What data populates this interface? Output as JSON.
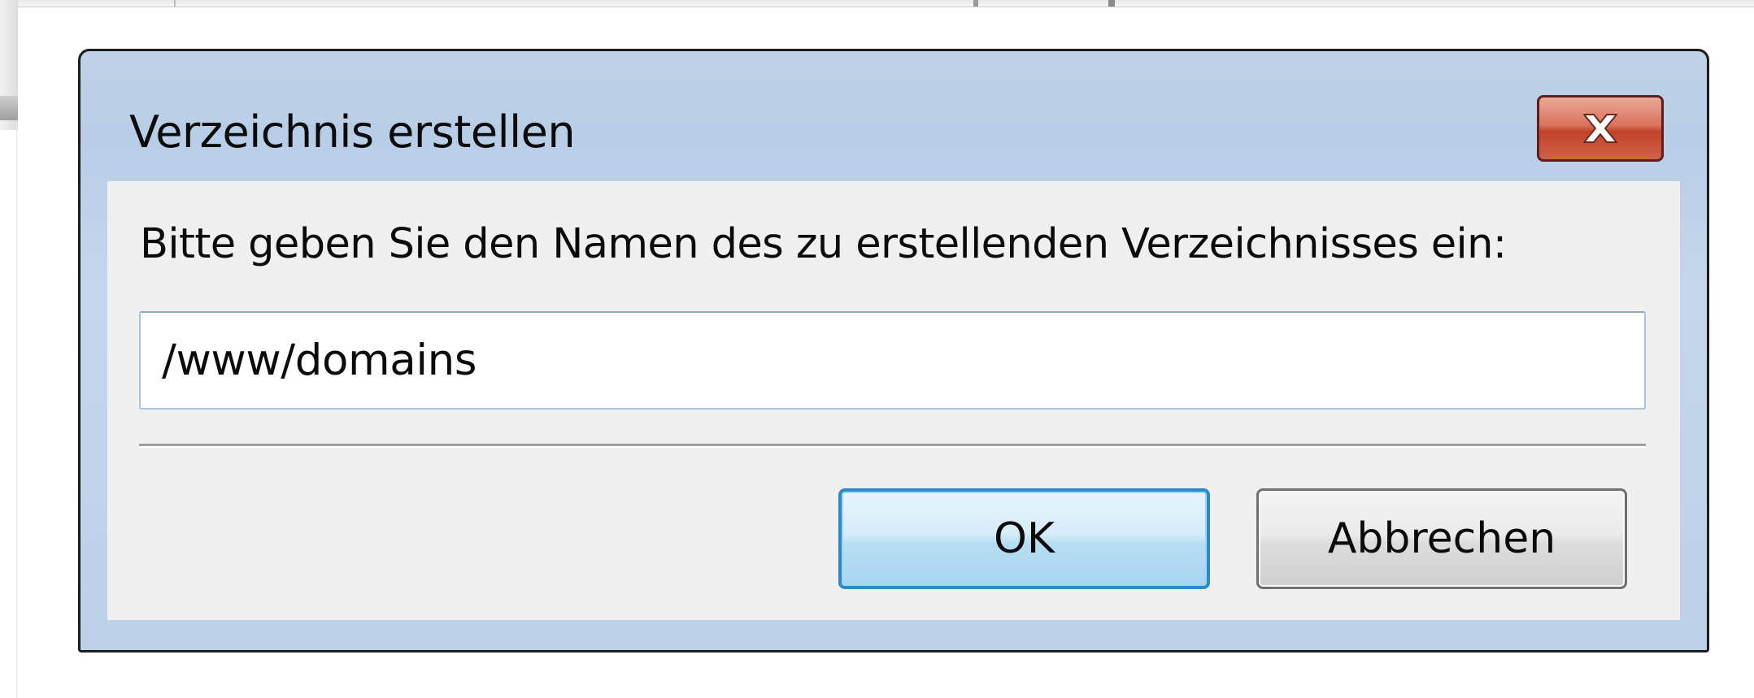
{
  "dialog": {
    "title": "Verzeichnis erstellen",
    "prompt": "Bitte geben Sie den Namen des zu erstellenden Verzeichnisses ein:",
    "input_value": "/www/domains",
    "ok_label": "OK",
    "cancel_label": "Abbrechen",
    "close_icon": "close-icon"
  },
  "colors": {
    "title_bar": "#b7cde6",
    "close_button": "#c2422a",
    "client_area": "#f0f0f0",
    "ok_border": "#2d88c8"
  }
}
